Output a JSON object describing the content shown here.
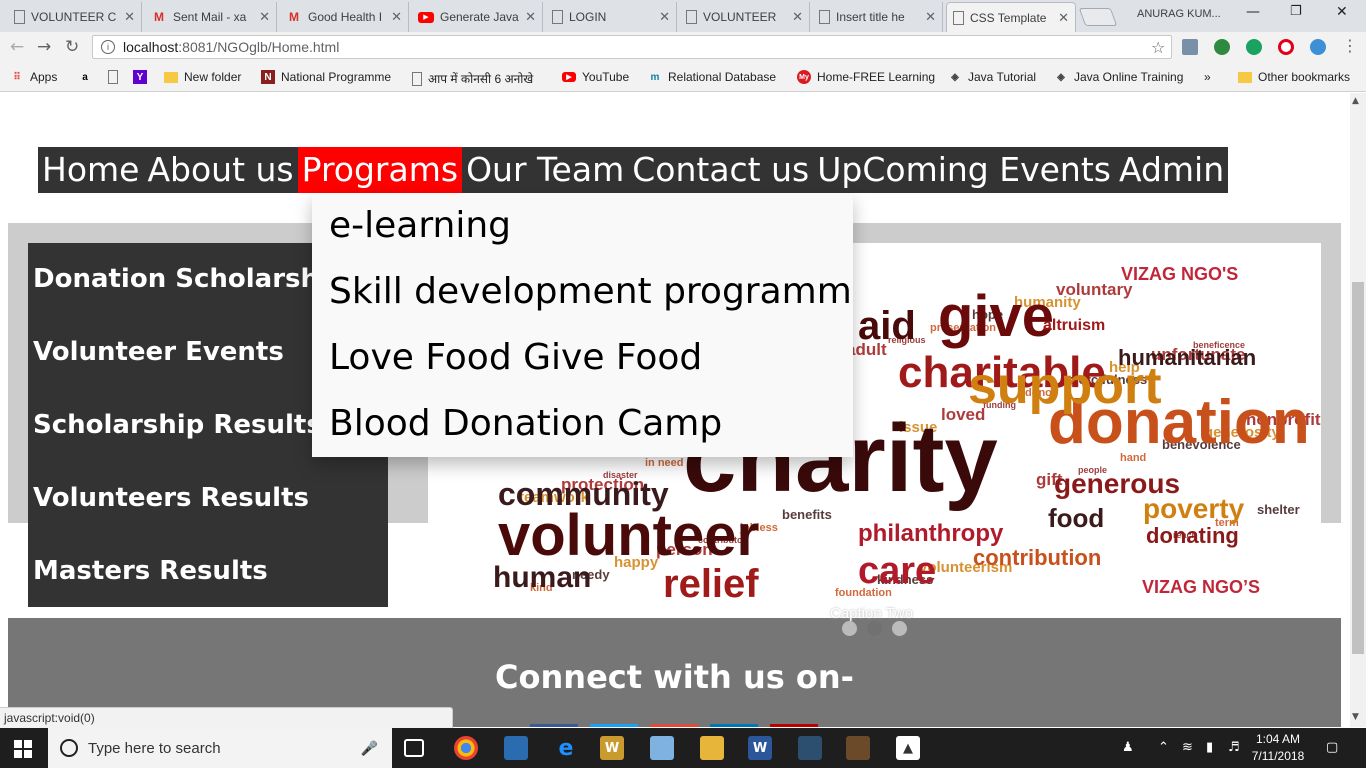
{
  "browser": {
    "tabs": [
      {
        "title": "VOLUNTEER C",
        "icon": "doc-icon",
        "active": false
      },
      {
        "title": "Sent Mail - xa",
        "icon": "gmail-icon",
        "active": false
      },
      {
        "title": "Good Health I",
        "icon": "gmail-icon",
        "active": false
      },
      {
        "title": "Generate Java",
        "icon": "youtube-icon",
        "active": false
      },
      {
        "title": "LOGIN",
        "icon": "doc-icon",
        "active": false
      },
      {
        "title": "VOLUNTEER",
        "icon": "doc-icon",
        "active": false
      },
      {
        "title": "Insert title he",
        "icon": "doc-icon",
        "active": false
      },
      {
        "title": "CSS Template",
        "icon": "doc-icon",
        "active": true
      }
    ],
    "profile_name": "ANURAG KUM...",
    "url_host": "localhost",
    "url_path": ":8081/NGOglb/Home.html",
    "bookmarks": [
      {
        "label": "Apps",
        "icon": "apps-grid-icon"
      },
      {
        "label": "",
        "icon": "amazon-icon"
      },
      {
        "label": "",
        "icon": "page-icon"
      },
      {
        "label": "",
        "icon": "yahoo-icon"
      },
      {
        "label": "New folder",
        "icon": "folder-icon"
      },
      {
        "label": "National Programme",
        "icon": "nptel-icon"
      },
      {
        "label": "आप में कोनसी 6 अनोखे",
        "icon": "page-icon"
      },
      {
        "label": "YouTube",
        "icon": "youtube-icon"
      },
      {
        "label": "Relational Database",
        "icon": "m-icon"
      },
      {
        "label": "Home-FREE Learning",
        "icon": "my-icon"
      },
      {
        "label": "Java Tutorial",
        "icon": "diamond-icon"
      },
      {
        "label": "Java Online Training",
        "icon": "diamond-icon"
      },
      {
        "label": "»",
        "icon": ""
      },
      {
        "label": "Other bookmarks",
        "icon": "folder-icon"
      }
    ],
    "status_text": "javascript:void(0)"
  },
  "page": {
    "nav": [
      "Home",
      "About us",
      "Programs",
      "Our Team",
      "Contact us",
      "UpComing Events",
      "Admin"
    ],
    "active_nav": "Programs",
    "dropdown": [
      "e-learning",
      "Skill development programm",
      "Love Food Give Food",
      "Blood Donation Camp"
    ],
    "sidebar": [
      "Donation Scholarship",
      "Volunteer Events",
      "Scholarship Results",
      "Volunteers Results",
      "Masters Results"
    ],
    "banner": {
      "caption": "Caption Two",
      "words": [
        {
          "t": "charity",
          "c": "#3a0a0a"
        },
        {
          "t": "donation",
          "c": "#c8501a"
        },
        {
          "t": "volunteer",
          "c": "#4a0a0a"
        },
        {
          "t": "charitable",
          "c": "#a01a1a"
        },
        {
          "t": "support",
          "c": "#d08010"
        },
        {
          "t": "give",
          "c": "#6a0a0a"
        },
        {
          "t": "community",
          "c": "#3a1a1a"
        },
        {
          "t": "care",
          "c": "#b01a2a"
        },
        {
          "t": "relief",
          "c": "#a01a1a"
        },
        {
          "t": "human",
          "c": "#3a1a1a"
        },
        {
          "t": "humanitarian",
          "c": "#3a1a1a"
        },
        {
          "t": "generous",
          "c": "#8a1a1a"
        },
        {
          "t": "food",
          "c": "#3a1a1a"
        },
        {
          "t": "poverty",
          "c": "#d08010"
        },
        {
          "t": "philanthropy",
          "c": "#b01a2a"
        },
        {
          "t": "contribution",
          "c": "#c8501a"
        },
        {
          "t": "donating",
          "c": "#8a1a1a"
        },
        {
          "t": "aid",
          "c": "#4a0a0a"
        },
        {
          "t": "altruism",
          "c": "#a01a1a"
        },
        {
          "t": "VIZAG NGO'S",
          "c": "#c0283a"
        },
        {
          "t": "VIZAG NGO’S",
          "c": "#c0283a"
        }
      ]
    },
    "footer_title": "Connect with us on-",
    "social_colors": [
      "#3b5998",
      "#1da1f2",
      "#dd4b39",
      "#0077b5",
      "#bb0000"
    ]
  },
  "taskbar": {
    "search_placeholder": "Type here to search",
    "time": "1:04 AM",
    "date": "7/11/2018"
  }
}
